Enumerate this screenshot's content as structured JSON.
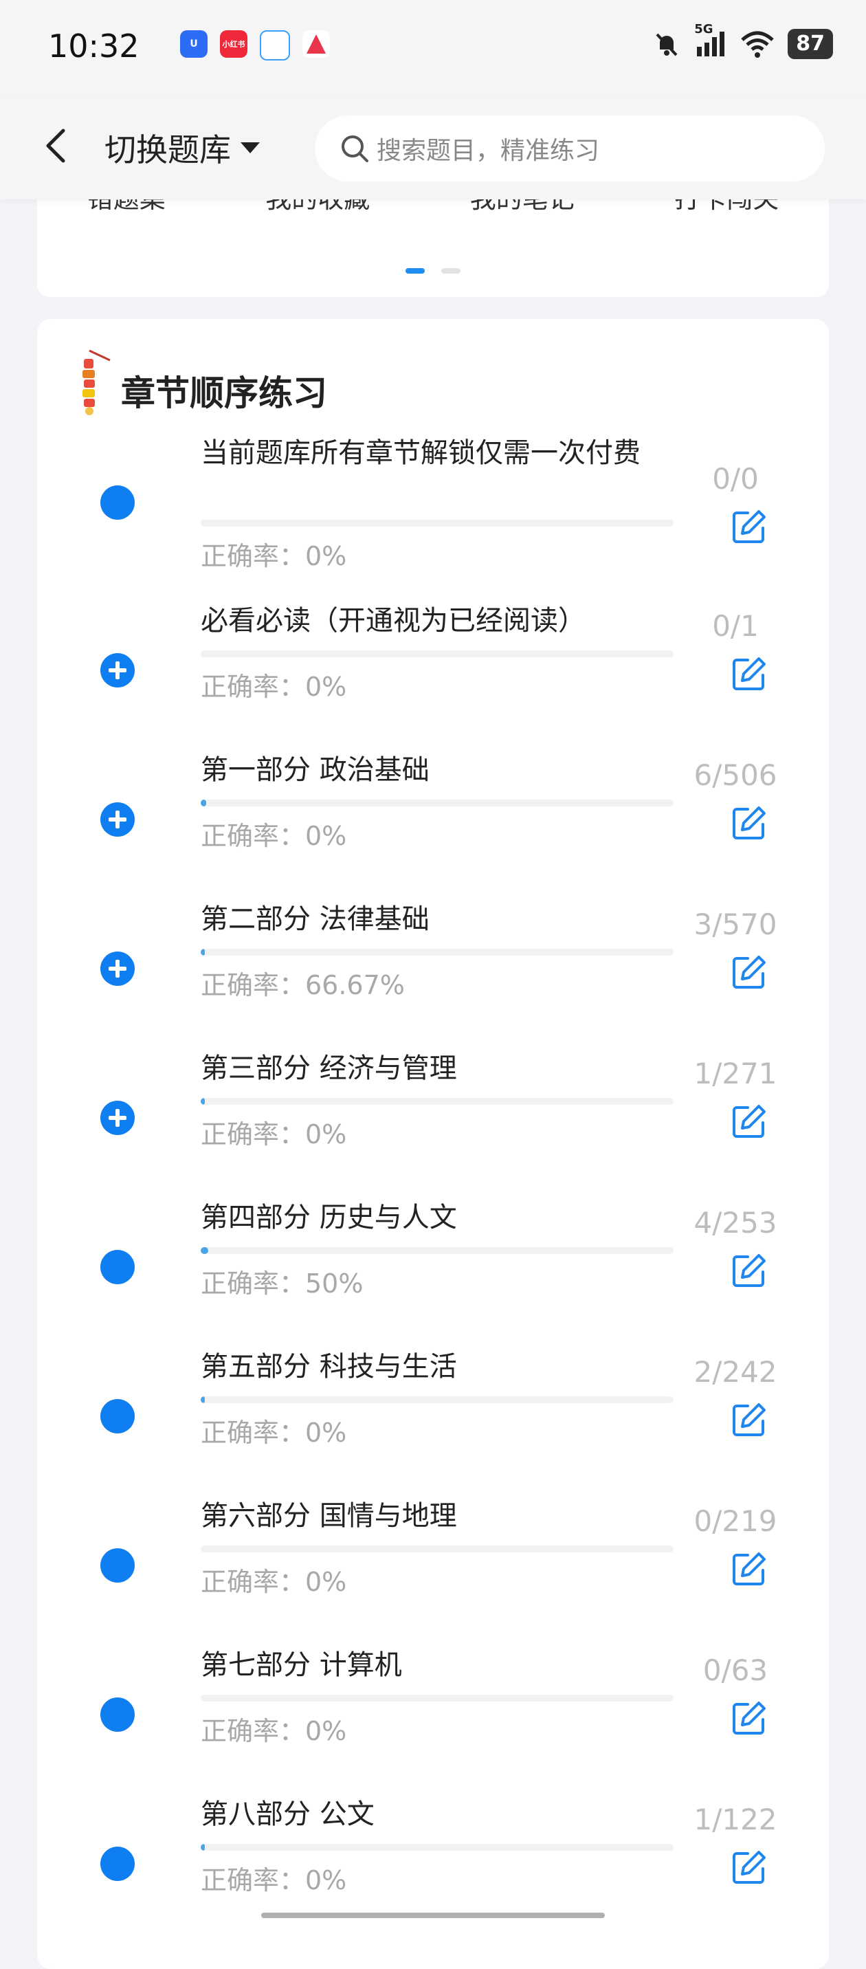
{
  "status_bar": {
    "time": "10:32",
    "app_icons": [
      "app-icon-blue",
      "app-icon-red",
      "app-icon-chat",
      "app-icon-red-triangle"
    ],
    "app_icon_texts": [
      "U",
      "小红书"
    ],
    "signal": "5G",
    "battery": "87"
  },
  "header": {
    "back_icon": "chevron-left-icon",
    "switch_label": "切换题库",
    "search_placeholder": "搜索题目，精准练习"
  },
  "shortcuts": [
    "错题集",
    "我的收藏",
    "我的笔记",
    "打卡闯关"
  ],
  "chapter_section": {
    "title": "章节顺序练习",
    "items": [
      {
        "title": "当前题库所有章节解锁仅需一次付费",
        "accuracy": "正确率：0%",
        "count": "0/0",
        "progress": 0,
        "expandable": false
      },
      {
        "title": "必看必读（开通视为已经阅读）",
        "accuracy": "正确率：0%",
        "count": "0/1",
        "progress": 0,
        "expandable": true
      },
      {
        "title": "第一部分 政治基础",
        "accuracy": "正确率：0%",
        "count": "6/506",
        "progress": 0.0119,
        "expandable": true
      },
      {
        "title": "第二部分 法律基础",
        "accuracy": "正确率：66.67%",
        "count": "3/570",
        "progress": 0.0053,
        "expandable": true
      },
      {
        "title": "第三部分 经济与管理",
        "accuracy": "正确率：0%",
        "count": "1/271",
        "progress": 0.0037,
        "expandable": true
      },
      {
        "title": "第四部分 历史与人文",
        "accuracy": "正确率：50%",
        "count": "4/253",
        "progress": 0.0158,
        "expandable": false
      },
      {
        "title": "第五部分 科技与生活",
        "accuracy": "正确率：0%",
        "count": "2/242",
        "progress": 0.0083,
        "expandable": false
      },
      {
        "title": "第六部分 国情与地理",
        "accuracy": "正确率：0%",
        "count": "0/219",
        "progress": 0,
        "expandable": false
      },
      {
        "title": "第七部分 计算机",
        "accuracy": "正确率：0%",
        "count": "0/63",
        "progress": 0,
        "expandable": false
      },
      {
        "title": "第八部分 公文",
        "accuracy": "正确率：0%",
        "count": "1/122",
        "progress": 0.0082,
        "expandable": false
      }
    ]
  },
  "colors": {
    "accent": "#0f7ef0",
    "progress": "#4aa3e6",
    "muted": "#a8a8a8"
  }
}
